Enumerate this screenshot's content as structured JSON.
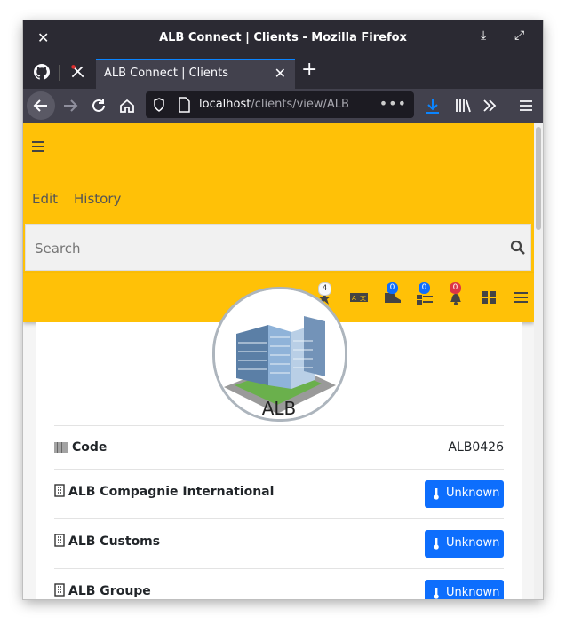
{
  "window": {
    "title": "ALB Connect | Clients - Mozilla Firefox"
  },
  "tab": {
    "title": "ALB Connect | Clients"
  },
  "urlbar": {
    "host": "localhost",
    "path": "/clients/view/ALB"
  },
  "menu": {
    "edit": "Edit",
    "history": "History"
  },
  "search": {
    "placeholder": "Search"
  },
  "icons": {
    "badges": {
      "favorites": "4",
      "cart": "0",
      "tasks": "0",
      "notifications": "0"
    },
    "names": [
      "favorites-icon",
      "translate-icon",
      "cart-icon",
      "tasks-icon",
      "bell-icon",
      "apps-icon",
      "menu-icon"
    ]
  },
  "client": {
    "name": "ALB",
    "code_label": "Code",
    "code_value": "ALB0426",
    "companies": [
      {
        "name": "ALB Compagnie International",
        "status": "Unknown"
      },
      {
        "name": "ALB Customs",
        "status": "Unknown"
      },
      {
        "name": "ALB Groupe",
        "status": "Unknown"
      }
    ]
  },
  "colors": {
    "accent": "#ffc107",
    "primary": "#0d6efd",
    "badge_blue": "#0d6efd",
    "badge_red": "#dc3545"
  }
}
